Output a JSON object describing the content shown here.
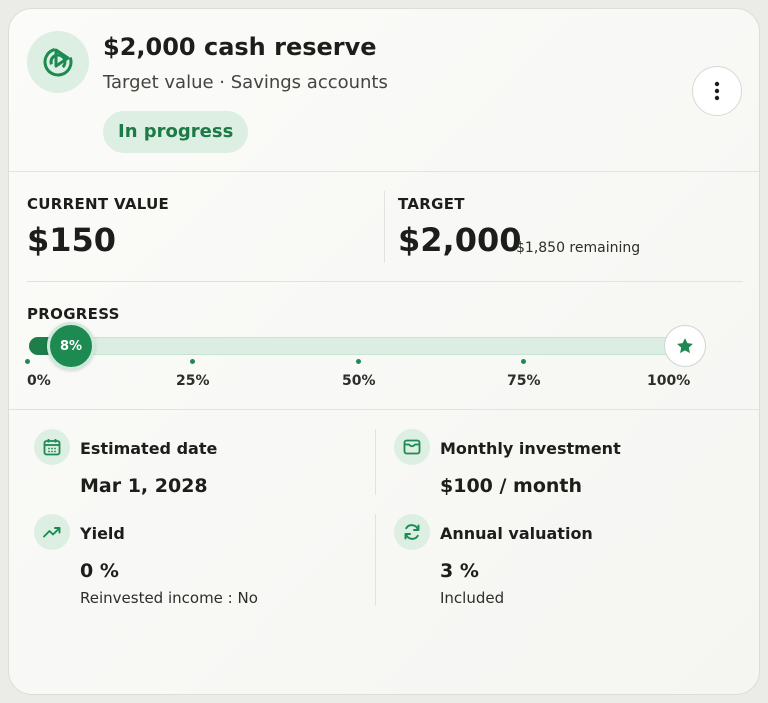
{
  "header": {
    "title": "$2,000 cash reserve",
    "subtitle": "Target value · Savings accounts",
    "status_badge": "In progress",
    "icon": "target-play-icon",
    "menu_icon": "more-vertical-icon"
  },
  "summary": {
    "current_label": "CURRENT VALUE",
    "current_value": "$150",
    "target_label": "TARGET",
    "target_value": "$2,000",
    "remaining": "$1,850 remaining"
  },
  "progress": {
    "label": "PROGRESS",
    "fraction": 0.08,
    "knob_label": "8%",
    "ticks": [
      "0%",
      "25%",
      "50%",
      "75%",
      "100%"
    ],
    "goal_icon": "star-icon"
  },
  "details": {
    "estimated_date": {
      "icon": "calendar-icon",
      "label": "Estimated date",
      "value": "Mar 1, 2028"
    },
    "monthly_investment": {
      "icon": "wallet-icon",
      "label": "Monthly investment",
      "value": "$100 / month"
    },
    "yield": {
      "icon": "trending-up-icon",
      "label": "Yield",
      "value": "0 %",
      "note": "Reinvested income : No"
    },
    "annual_valuation": {
      "icon": "refresh-icon",
      "label": "Annual valuation",
      "value": "3 %",
      "note": "Included"
    }
  },
  "colors": {
    "accent": "#1d8a52",
    "accent_dark": "#1d7e49",
    "accent_soft": "#dcefe2",
    "badge_text": "#1b7a45",
    "text": "#1d1d1b"
  }
}
